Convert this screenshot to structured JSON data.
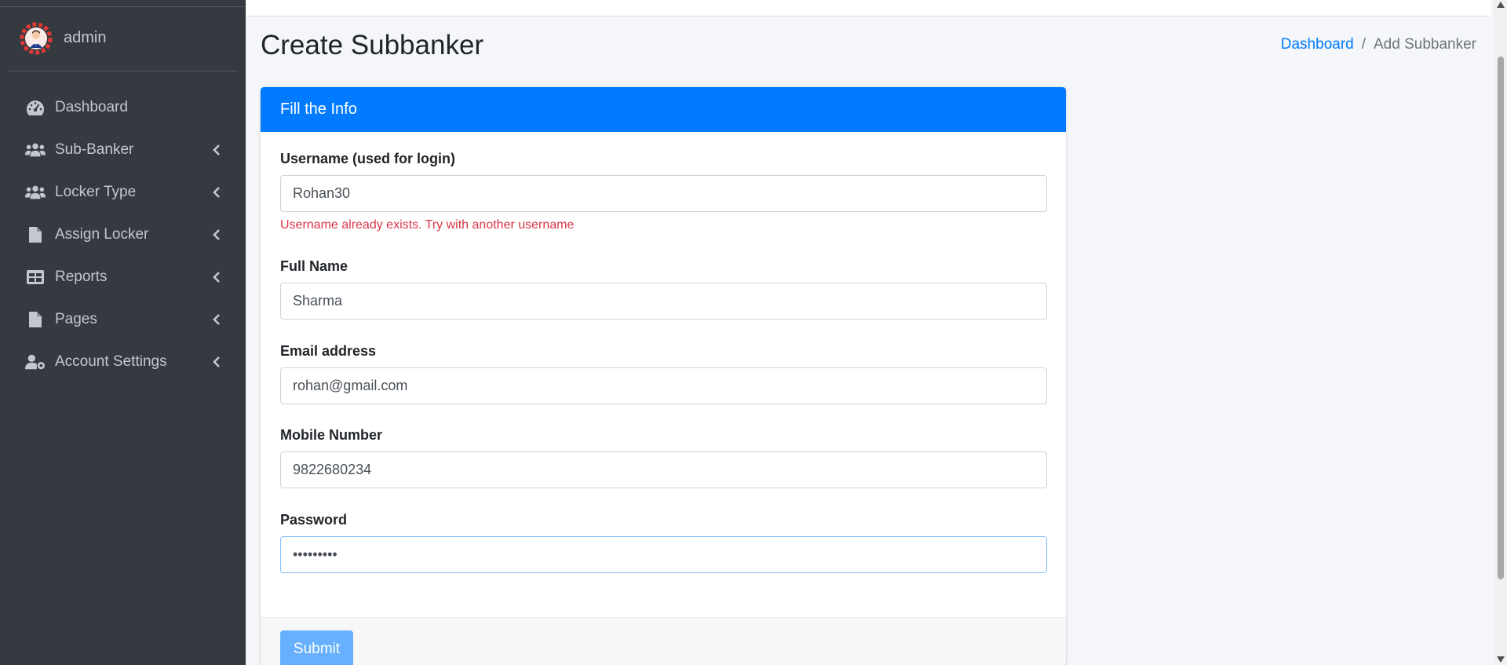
{
  "sidebar": {
    "user_name": "admin",
    "items": [
      {
        "label": "Dashboard",
        "icon": "tachometer-icon",
        "has_chevron": false
      },
      {
        "label": "Sub-Banker",
        "icon": "users-icon",
        "has_chevron": true
      },
      {
        "label": "Locker Type",
        "icon": "users-icon",
        "has_chevron": true
      },
      {
        "label": "Assign Locker",
        "icon": "file-icon",
        "has_chevron": true
      },
      {
        "label": "Reports",
        "icon": "table-icon",
        "has_chevron": true
      },
      {
        "label": "Pages",
        "icon": "file-icon",
        "has_chevron": true
      },
      {
        "label": "Account Settings",
        "icon": "user-cog-icon",
        "has_chevron": true
      }
    ]
  },
  "header": {
    "title": "Create Subbanker",
    "breadcrumb": {
      "link": "Dashboard",
      "separator": "/",
      "active": "Add Subbanker"
    }
  },
  "form": {
    "card_title": "Fill the Info",
    "username": {
      "label": "Username (used for login)",
      "value": "Rohan30",
      "error": "Username already exists. Try with another username"
    },
    "fullname": {
      "label": "Full Name",
      "value": "Sharma"
    },
    "email": {
      "label": "Email address",
      "value": "rohan@gmail.com"
    },
    "mobile": {
      "label": "Mobile Number",
      "value": "9822680234"
    },
    "password": {
      "label": "Password",
      "value": "abcdefghi"
    },
    "submit_label": "Submit"
  },
  "colors": {
    "sidebar_bg": "#343a40",
    "primary": "#007bff",
    "error": "#dc3545",
    "submit_disabled": "#66b0ff"
  }
}
